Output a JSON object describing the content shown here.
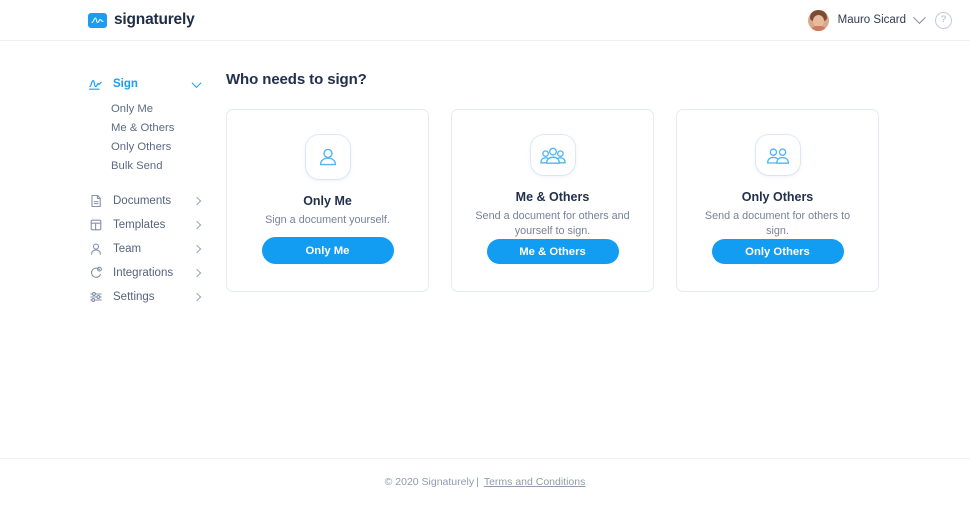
{
  "header": {
    "brand_name": "signaturely",
    "brand_icon": "signature-logo-icon",
    "user_name": "Mauro Sicard",
    "user_chevron_icon": "chevron-down-icon",
    "help_icon": "help-circle-icon",
    "help_glyph": "?",
    "avatar_label": "Mauro Sicard"
  },
  "sidebar": {
    "items": [
      {
        "label": "Sign",
        "icon": "signature-icon",
        "active": true,
        "arrow": "chevron-down-icon"
      },
      {
        "label": "Documents",
        "icon": "document-icon",
        "active": false,
        "arrow": "chevron-right-icon"
      },
      {
        "label": "Templates",
        "icon": "templates-grid-icon",
        "active": false,
        "arrow": "chevron-right-icon"
      },
      {
        "label": "Team",
        "icon": "user-icon",
        "active": false,
        "arrow": "chevron-right-icon"
      },
      {
        "label": "Integrations",
        "icon": "integrations-icon",
        "active": false,
        "arrow": "chevron-right-icon"
      },
      {
        "label": "Settings",
        "icon": "sliders-icon",
        "active": false,
        "arrow": "chevron-right-icon"
      }
    ],
    "sub_items": [
      {
        "label": "Only Me"
      },
      {
        "label": "Me & Others"
      },
      {
        "label": "Only Others"
      },
      {
        "label": "Bulk Send"
      }
    ]
  },
  "main": {
    "title": "Who needs to sign?",
    "cards": [
      {
        "icon": "single-person-icon",
        "title": "Only Me",
        "description": "Sign a document yourself.",
        "button_label": "Only Me"
      },
      {
        "icon": "three-people-icon",
        "title": "Me & Others",
        "description": "Send a document for others and yourself to sign.",
        "button_label": "Me & Others"
      },
      {
        "icon": "two-people-icon",
        "title": "Only Others",
        "description": "Send a document for others to sign.",
        "button_label": "Only Others"
      }
    ]
  },
  "footer": {
    "copyright": "© 2020 Signaturely",
    "separator": "|",
    "link_label": "Terms and Conditions"
  },
  "colors": {
    "accent_blue": "#139df2",
    "icon_blue": "#4fb6f7",
    "title_navy": "#22304d",
    "muted_text": "#76839a",
    "card_border": "#e4eaf4"
  }
}
